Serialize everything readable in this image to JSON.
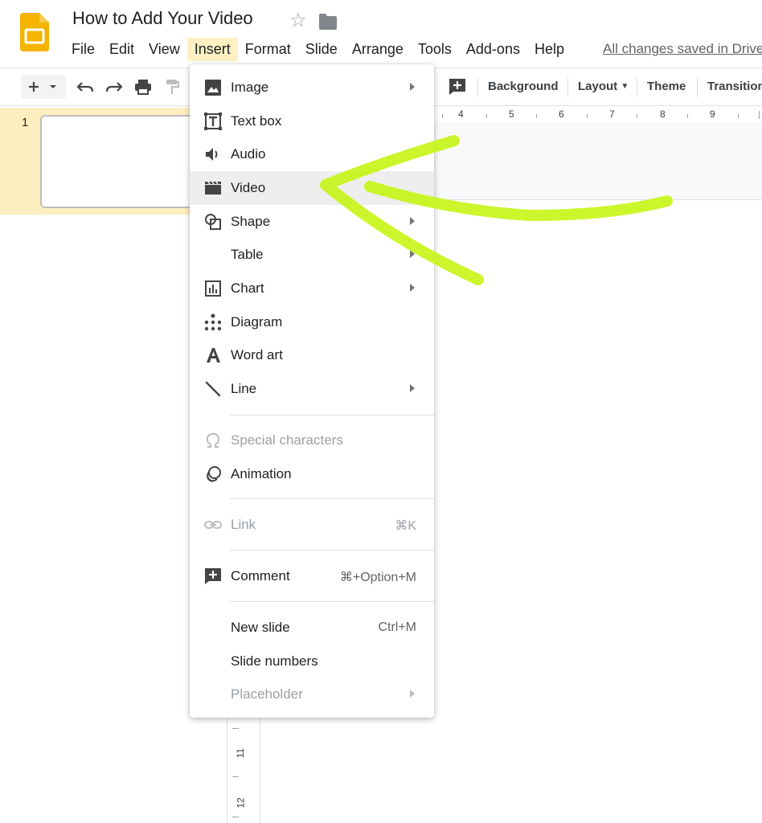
{
  "header": {
    "doc_title": "How to Add Your Video",
    "save_status": "All changes saved in Drive"
  },
  "menubar": [
    {
      "label": "File"
    },
    {
      "label": "Edit"
    },
    {
      "label": "View"
    },
    {
      "label": "Insert"
    },
    {
      "label": "Format"
    },
    {
      "label": "Slide"
    },
    {
      "label": "Arrange"
    },
    {
      "label": "Tools"
    },
    {
      "label": "Add-ons"
    },
    {
      "label": "Help"
    }
  ],
  "toolbar": {
    "background_label": "Background",
    "layout_label": "Layout",
    "theme_label": "Theme",
    "transition_label": "Transition"
  },
  "filmstrip": {
    "slide_number": "1"
  },
  "ruler": {
    "horizontal_labels": [
      "4",
      "5",
      "6",
      "7",
      "8",
      "9"
    ],
    "vertical_labels": [
      "11",
      "12"
    ]
  },
  "insert_menu": {
    "items": [
      {
        "label": "Image",
        "icon": "image-icon",
        "submenu": true
      },
      {
        "label": "Text box",
        "icon": "text-box-icon",
        "submenu": false
      },
      {
        "label": "Audio",
        "icon": "audio-icon",
        "submenu": false
      },
      {
        "label": "Video",
        "icon": "video-icon",
        "submenu": false
      },
      {
        "label": "Shape",
        "icon": "shape-icon",
        "submenu": true
      },
      {
        "label": "Table",
        "icon": "",
        "submenu": true
      },
      {
        "label": "Chart",
        "icon": "chart-icon",
        "submenu": true
      },
      {
        "label": "Diagram",
        "icon": "diagram-icon",
        "submenu": false
      },
      {
        "label": "Word art",
        "icon": "word-art-icon",
        "submenu": false
      },
      {
        "label": "Line",
        "icon": "line-icon",
        "submenu": true
      },
      {
        "label": "Special characters",
        "icon": "omega-icon",
        "disabled": true
      },
      {
        "label": "Animation",
        "icon": "animation-icon"
      },
      {
        "label": "Link",
        "icon": "link-icon",
        "shortcut": "⌘K",
        "disabled": true
      },
      {
        "label": "Comment",
        "icon": "comment-icon",
        "shortcut": "⌘+Option+M"
      },
      {
        "label": "New slide",
        "shortcut": "Ctrl+M"
      },
      {
        "label": "Slide numbers"
      },
      {
        "label": "Placeholder",
        "submenu": true,
        "disabled": true
      }
    ]
  },
  "annotation": {
    "color": "#c8f51a"
  },
  "colors": {
    "accent_yellow": "#f4b400",
    "menu_highlight": "#eeeeee",
    "active_menu_bg": "#fdf1c3"
  }
}
